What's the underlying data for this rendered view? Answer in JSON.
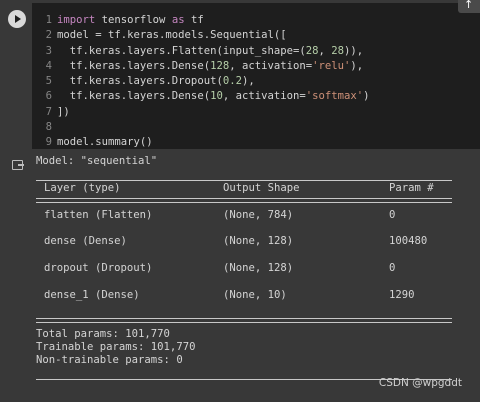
{
  "code": {
    "line_numbers": [
      "1",
      "2",
      "3",
      "4",
      "5",
      "6",
      "7",
      "8",
      "9"
    ],
    "line1": {
      "kw1": "import",
      "mid": " tensorflow ",
      "kw2": "as",
      "end": " tf"
    },
    "line2": {
      "text": "model = tf.keras.models.Sequential(["
    },
    "line3": {
      "a": "  tf.keras.layers.Flatten(input_shape=(",
      "n1": "28",
      "b": ", ",
      "n2": "28",
      "c": ")),"
    },
    "line4": {
      "a": "  tf.keras.layers.Dense(",
      "n1": "128",
      "b": ", activation=",
      "s": "'relu'",
      "c": "),"
    },
    "line5": {
      "a": "  tf.keras.layers.Dropout(",
      "n1": "0.2",
      "c": "),"
    },
    "line6": {
      "a": "  tf.keras.layers.Dense(",
      "n1": "10",
      "b": ", activation=",
      "s": "'softmax'",
      "c": ")"
    },
    "line7": {
      "text": "])"
    },
    "line8": {
      "text": ""
    },
    "line9": {
      "text": "model.summary()"
    }
  },
  "output": {
    "model_line": "Model: \"sequential\"",
    "headers": {
      "layer": "Layer (type)",
      "shape": "Output Shape",
      "param": "Param #"
    },
    "rows": [
      {
        "layer": "flatten (Flatten)",
        "shape": "(None, 784)",
        "param": "0"
      },
      {
        "layer": "dense (Dense)",
        "shape": "(None, 128)",
        "param": "100480"
      },
      {
        "layer": "dropout (Dropout)",
        "shape": "(None, 128)",
        "param": "0"
      },
      {
        "layer": "dense_1 (Dense)",
        "shape": "(None, 10)",
        "param": "1290"
      }
    ],
    "total_params": "Total params: 101,770",
    "trainable_params": "Trainable params: 101,770",
    "non_trainable_params": "Non-trainable params: 0"
  },
  "top_arrow_glyph": "↑",
  "watermark": "CSDN @wpgddt"
}
